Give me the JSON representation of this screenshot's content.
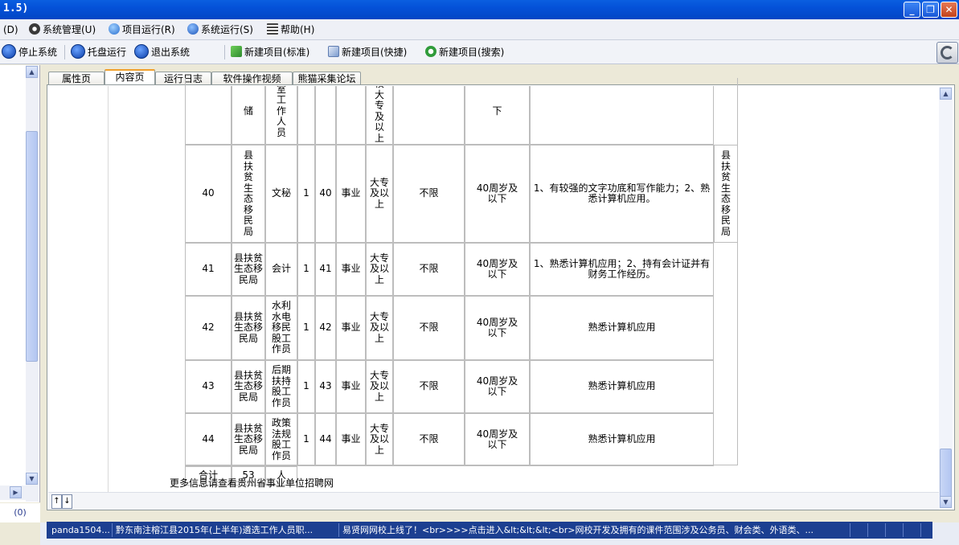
{
  "window": {
    "title": "1.5)"
  },
  "menu": [
    {
      "label": "(D)",
      "icon": "menu-icon"
    },
    {
      "label": "系统管理(U)",
      "icon": "gear-icon"
    },
    {
      "label": "项目运行(R)",
      "icon": "globe-icon"
    },
    {
      "label": "系统运行(S)",
      "icon": "run-icon"
    },
    {
      "label": "帮助(H)",
      "icon": "help-icon"
    }
  ],
  "toolbar": {
    "stop": "停止系统",
    "tray": "托盘运行",
    "exit": "退出系统",
    "new_standard": "新建项目(标准)",
    "new_quick": "新建项目(快捷)",
    "new_search": "新建项目(搜索)"
  },
  "tabs": [
    "属性页",
    "内容页",
    "运行日志",
    "软件操作视频",
    "熊猫采集论坛"
  ],
  "active_tab": "内容页",
  "table": {
    "partial_row": {
      "c2": "储",
      "c3": "室工作人员",
      "c6": "校大专及以上",
      "c8": "下"
    },
    "rows": [
      {
        "no": "40",
        "dept": "县扶贫生态移民局",
        "post": "文秘",
        "num": "1",
        "code": "40",
        "type": "事业",
        "edu": "大专及以上",
        "major": "不限",
        "age": "40周岁及以下",
        "req": "1、有较强的文字功底和写作能力；2、熟悉计算机应用。",
        "note": "县扶贫生态移民局"
      },
      {
        "no": "41",
        "dept": "县扶贫生态移民局",
        "post": "会计",
        "num": "1",
        "code": "41",
        "type": "事业",
        "edu": "大专及以上",
        "major": "不限",
        "age": "40周岁及以下",
        "req": "1、熟悉计算机应用；2、持有会计证并有财务工作经历。",
        "note": ""
      },
      {
        "no": "42",
        "dept": "县扶贫生态移民局",
        "post": "水利水电移民股工作员",
        "num": "1",
        "code": "42",
        "type": "事业",
        "edu": "大专及以上",
        "major": "不限",
        "age": "40周岁及以下",
        "req": "熟悉计算机应用",
        "note": ""
      },
      {
        "no": "43",
        "dept": "县扶贫生态移民局",
        "post": "后期扶持股工作员",
        "num": "1",
        "code": "43",
        "type": "事业",
        "edu": "大专及以上",
        "major": "不限",
        "age": "40周岁及以下",
        "req": "熟悉计算机应用",
        "note": ""
      },
      {
        "no": "44",
        "dept": "县扶贫生态移民局",
        "post": "政策法规股工作员",
        "num": "1",
        "code": "44",
        "type": "事业",
        "edu": "大专及以上",
        "major": "不限",
        "age": "40周岁及以下",
        "req": "熟悉计算机应用",
        "note": ""
      }
    ],
    "total": {
      "label": "合计",
      "count": "53",
      "unit": "人"
    }
  },
  "more_info": "更多信息请查看贵州省事业单位招聘网",
  "left_count": "(0)",
  "status": [
    "panda1504...",
    "黔东南注榕江县2015年(上半年)遴选工作人员职...",
    "易贤网网校上线了！<br>>>>点击进入&lt;&lt;&lt;<br>网校开发及拥有的课件范围涉及公务员、财会类、外语类、..."
  ],
  "colors": {
    "titlebar": "#0451d8",
    "status_strip": "#1c3f91",
    "active_tab_accent": "#f0a02c"
  }
}
